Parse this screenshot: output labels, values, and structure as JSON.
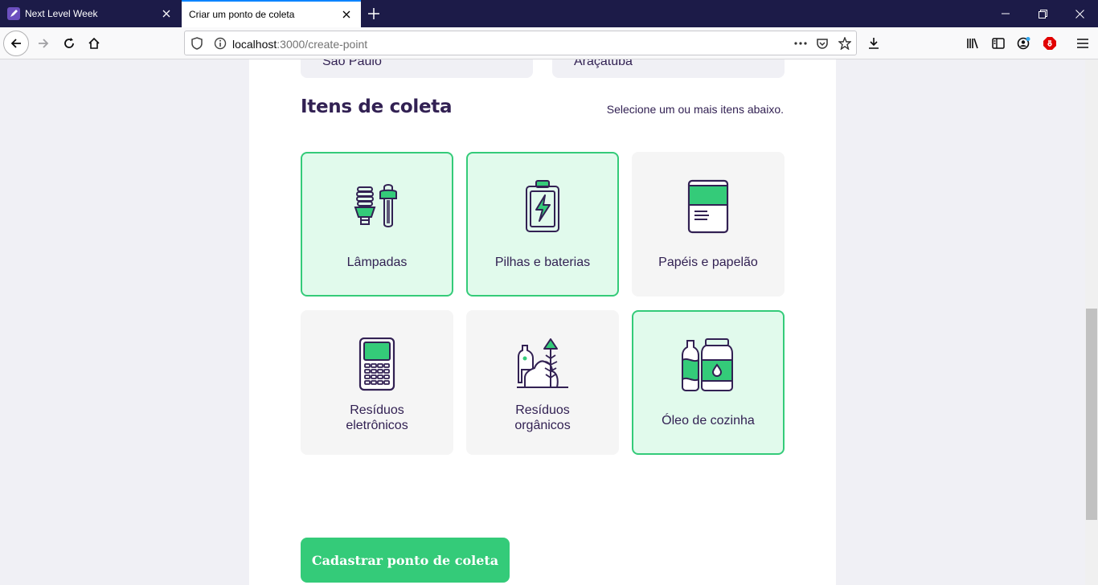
{
  "browser": {
    "tabs": [
      {
        "title": "Next Level Week",
        "active": false
      },
      {
        "title": "Criar um ponto de coleta",
        "active": true
      }
    ],
    "url_host": "localhost",
    "url_path": ":3000/create-point",
    "icons": [
      "back-icon",
      "forward-icon",
      "reload-icon",
      "home-icon",
      "shield-icon",
      "info-icon",
      "more-icon",
      "pocket-icon",
      "star-icon",
      "download-icon",
      "library-icon",
      "sidebar-icon",
      "account-icon",
      "adblock-icon",
      "menu-icon"
    ]
  },
  "form": {
    "uf_value": "São Paulo",
    "city_value": "Araçatuba",
    "items_legend": "Itens de coleta",
    "items_hint": "Selecione um ou mais itens abaixo.",
    "items": [
      {
        "label": "Lâmpadas",
        "selected": true,
        "icon": "lamp-icon"
      },
      {
        "label": "Pilhas e baterias",
        "selected": true,
        "icon": "battery-icon"
      },
      {
        "label": "Papéis e papelão",
        "selected": false,
        "icon": "paper-icon"
      },
      {
        "label_line1": "Resíduos",
        "label_line2": "eletrônicos",
        "selected": false,
        "icon": "electronics-icon"
      },
      {
        "label_line1": "Resíduos",
        "label_line2": "orgânicos",
        "selected": false,
        "icon": "organic-icon"
      },
      {
        "label": "Óleo de cozinha",
        "selected": true,
        "icon": "oil-icon"
      }
    ],
    "submit_label": "Cadastrar ponto de coleta"
  },
  "colors": {
    "primary": "#34cb79",
    "title": "#322153",
    "selected_bg": "#e1faec",
    "item_bg": "#f5f5f5",
    "page_bg": "#f0f0f5",
    "tabbar_bg": "#1c1b48"
  }
}
